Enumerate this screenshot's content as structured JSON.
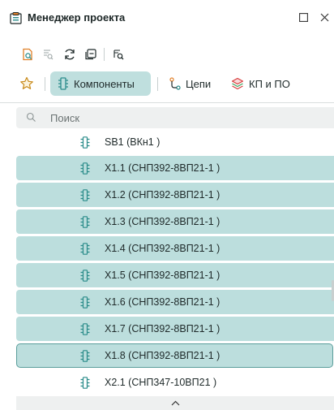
{
  "window": {
    "title": "Менеджер проекта"
  },
  "toolbar": {
    "buttons": [
      "open-project-icon",
      "find-text-icon",
      "refresh-icon",
      "collapse-icon",
      "search-replace-icon"
    ]
  },
  "tabs": [
    {
      "label": "Компоненты",
      "icon": "component-icon",
      "active": true
    },
    {
      "label": "Цепи",
      "icon": "net-icon",
      "active": false
    },
    {
      "label": "КП и ПО",
      "icon": "layers-icon",
      "active": false
    }
  ],
  "search": {
    "placeholder": "Поиск"
  },
  "items": [
    {
      "label": "SB1 (ВКн1 )",
      "selected": false
    },
    {
      "label": "X1.1 (СНП392-8ВП21-1 )",
      "selected": true
    },
    {
      "label": "X1.2 (СНП392-8ВП21-1 )",
      "selected": true
    },
    {
      "label": "X1.3 (СНП392-8ВП21-1 )",
      "selected": true
    },
    {
      "label": "X1.4 (СНП392-8ВП21-1 )",
      "selected": true
    },
    {
      "label": "X1.5 (СНП392-8ВП21-1 )",
      "selected": true
    },
    {
      "label": "X1.6 (СНП392-8ВП21-1 )",
      "selected": true
    },
    {
      "label": "X1.7 (СНП392-8ВП21-1 )",
      "selected": true
    },
    {
      "label": "X1.8 (СНП392-8ВП21-1 )",
      "selected": true,
      "focused": true
    },
    {
      "label": "X2.1 (СНП347-10ВП21 )",
      "selected": false
    }
  ],
  "colors": {
    "accent": "#bcdedd",
    "accent_border": "#5a9e9b",
    "icon_teal": "#2a8c8a",
    "toolbar_orange": "#e0812a"
  }
}
